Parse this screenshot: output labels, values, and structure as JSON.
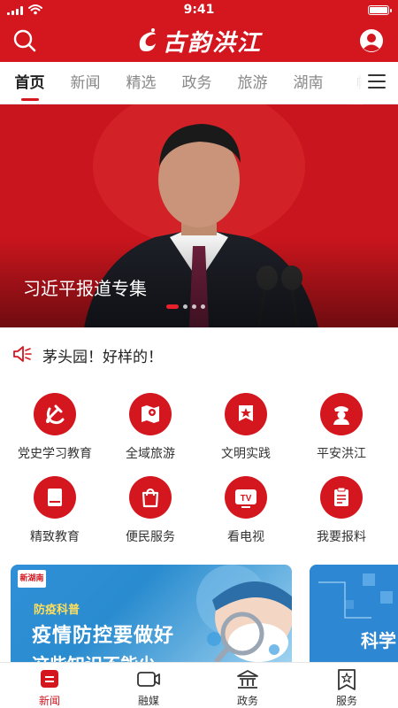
{
  "status_bar": {
    "time": "9:41"
  },
  "header": {
    "app_title": "古韵洪江"
  },
  "tabs": [
    "首页",
    "新闻",
    "精选",
    "政务",
    "旅游",
    "湖南",
    "帐"
  ],
  "banner": {
    "caption": "习近平报道专集",
    "slide_count": 4,
    "active_slide": 1
  },
  "notice": {
    "text": "茅头园！好样的！"
  },
  "services": [
    {
      "label": "党史学习教育",
      "icon": "hammer-sickle-icon"
    },
    {
      "label": "全域旅游",
      "icon": "map-pin-icon"
    },
    {
      "label": "文明实践",
      "icon": "star-banner-icon"
    },
    {
      "label": "平安洪江",
      "icon": "police-icon"
    },
    {
      "label": "精致教育",
      "icon": "book-icon"
    },
    {
      "label": "便民服务",
      "icon": "shopping-bag-icon"
    },
    {
      "label": "看电视",
      "icon": "tv-icon"
    },
    {
      "label": "我要报料",
      "icon": "clipboard-icon"
    }
  ],
  "cards": [
    {
      "logo": "新湖南",
      "tag": "防疫科普",
      "headline": "疫情防控要做好",
      "subline": "这些知识不能少"
    },
    {
      "partial_text": "科学"
    }
  ],
  "bottom_nav": [
    {
      "label": "新闻",
      "icon": "news-icon",
      "active": true
    },
    {
      "label": "融媒",
      "icon": "video-icon",
      "active": false
    },
    {
      "label": "政务",
      "icon": "government-icon",
      "active": false
    },
    {
      "label": "服务",
      "icon": "service-icon",
      "active": false
    }
  ],
  "colors": {
    "brand_red": "#d4161f",
    "card_blue": "#2f8fd8"
  }
}
